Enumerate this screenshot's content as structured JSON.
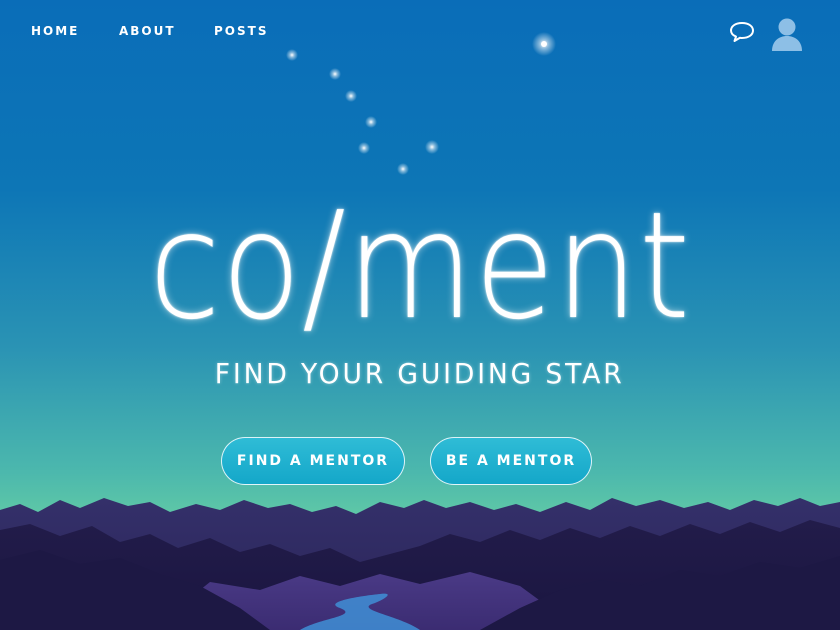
{
  "nav": {
    "home": "HOME",
    "about": "ABOUT",
    "posts": "POSTS",
    "chat_icon": "chat-bubble-icon",
    "avatar_icon": "user-avatar-icon"
  },
  "hero": {
    "brand": "co/ment",
    "tagline": "FIND YOUR GUIDING STAR",
    "cta_find": "FIND A MENTOR",
    "cta_be": "BE A MENTOR"
  },
  "colors": {
    "sky_top": "#0a6db8",
    "sky_bottom": "#5fc8a6",
    "button": "#14a7c9",
    "mountain_dark": "#1e1a45",
    "mountain_mid": "#3a2c6e",
    "river": "#3f8fd6"
  }
}
